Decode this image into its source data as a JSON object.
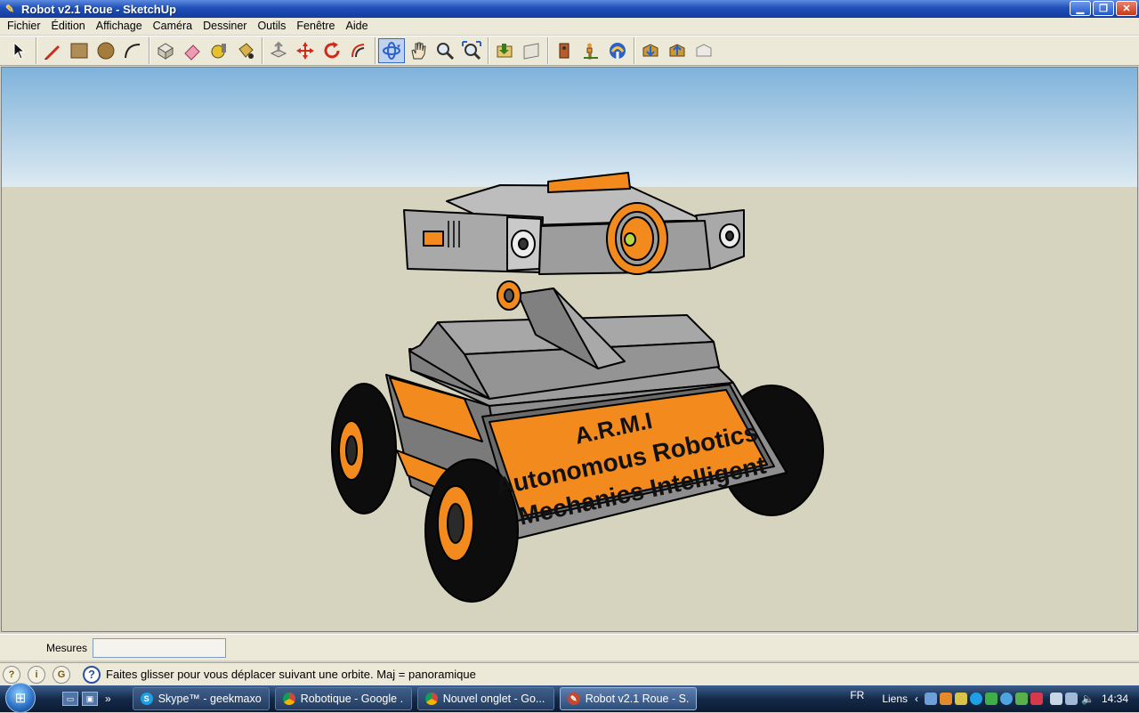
{
  "window": {
    "title": "Robot v2.1 Roue - SketchUp",
    "controls": [
      "minimize",
      "maximize",
      "close"
    ]
  },
  "menu": [
    "Fichier",
    "Édition",
    "Affichage",
    "Caméra",
    "Dessiner",
    "Outils",
    "Fenêtre",
    "Aide"
  ],
  "toolbar": {
    "groups": [
      [
        "select-tool-icon"
      ],
      [
        "pencil-line-icon",
        "rectangle-icon",
        "circle-icon",
        "arc-icon"
      ],
      [
        "make-component-icon",
        "eraser-icon",
        "tape-measure-icon",
        "paint-bucket-icon"
      ],
      [
        "push-pull-icon",
        "move-icon",
        "rotate-icon",
        "offset-icon"
      ],
      [
        "orbit-icon",
        "pan-icon",
        "zoom-icon",
        "zoom-extents-icon"
      ],
      [
        "previous-view-icon",
        "next-view-icon"
      ],
      [
        "position-camera-icon",
        "walk-icon",
        "look-around-icon"
      ],
      [
        "get-models-icon",
        "share-model-icon",
        "share-component-icon"
      ]
    ],
    "active_tool": "orbit-icon",
    "colors": {
      "orbit": "#2b62c9",
      "pencil": "#cc2a1a",
      "rectangle": "#b08d57",
      "circle": "#a67c3d"
    }
  },
  "model": {
    "plate_line1": "A.R.M.I",
    "plate_line2": "Autonomous Robotics",
    "plate_line3": "Mechanics Intelligent",
    "colors": {
      "sky_top": "#7fb3db",
      "sky_bottom": "#ddeaf2",
      "ground": "#d6d3bf",
      "body": "#8e8e8e",
      "orange": "#f28a1e",
      "tire": "#111111"
    }
  },
  "measurements": {
    "label": "Mesures",
    "value": ""
  },
  "status": {
    "text": "Faites glisser pour vous déplacer suivant une orbite.  Maj = panoramique"
  },
  "taskbar": {
    "items": [
      {
        "label": "Skype™ - geekmaxou",
        "icon": "skype-icon",
        "color": "#1ea0e6"
      },
      {
        "label": "Robotique - Google ...",
        "icon": "chrome-icon",
        "color": "#d8a12a"
      },
      {
        "label": "Nouvel onglet - Go...",
        "icon": "chrome-icon",
        "color": "#d8a12a"
      },
      {
        "label": "Robot v2.1 Roue - S...",
        "icon": "sketchup-icon",
        "color": "#c9472b",
        "active": true
      }
    ],
    "language": "FR",
    "links_label": "Liens",
    "clock": "14:34"
  }
}
